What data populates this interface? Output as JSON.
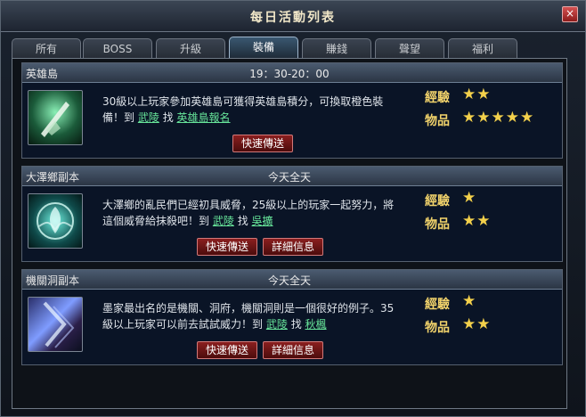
{
  "window": {
    "title": "每日活動列表",
    "close_glyph": "×"
  },
  "tabs": [
    {
      "label": "所有",
      "active": false
    },
    {
      "label": "BOSS",
      "active": false
    },
    {
      "label": "升級",
      "active": false
    },
    {
      "label": "裝備",
      "active": true
    },
    {
      "label": "賺錢",
      "active": false
    },
    {
      "label": "聲望",
      "active": false
    },
    {
      "label": "福利",
      "active": false
    }
  ],
  "activities": [
    {
      "name": "英雄島",
      "time": "19：30-20：00",
      "icon": "sword-blade-icon",
      "desc_text": "30級以上玩家參加英雄島可獲得英雄島積分，可換取橙色裝備！到",
      "location": "武陵",
      "find": "找",
      "npc": "英雄島報名",
      "buttons": [
        "快速傳送"
      ],
      "reward_exp_label": "經驗",
      "reward_exp_stars": "★★",
      "reward_item_label": "物品",
      "reward_item_stars": "★★★★★"
    },
    {
      "name": "大澤鄉副本",
      "time": "今天全天",
      "icon": "phoenix-emblem-icon",
      "desc_text": "大澤鄉的亂民們已經初具威脅，25級以上的玩家一起努力，將這個威脅給抹殺吧！到",
      "location": "武陵",
      "find": "找",
      "npc": "吳擴",
      "buttons": [
        "快速傳送",
        "詳細信息"
      ],
      "reward_exp_label": "經驗",
      "reward_exp_stars": "★",
      "reward_item_label": "物品",
      "reward_item_stars": "★★"
    },
    {
      "name": "機關洞副本",
      "time": "今天全天",
      "icon": "mechanism-cave-icon",
      "desc_text": "墨家最出名的是機關、洞府，機關洞則是一個很好的例子。35級以上玩家可以前去試試威力！到",
      "location": "武陵",
      "find": "找",
      "npc": "秋楓",
      "buttons": [
        "快速傳送",
        "詳細信息"
      ],
      "reward_exp_label": "經驗",
      "reward_exp_stars": "★",
      "reward_item_label": "物品",
      "reward_item_stars": "★★"
    }
  ],
  "scrollbar": {
    "up_glyph": "▲",
    "down_glyph": "▼"
  }
}
